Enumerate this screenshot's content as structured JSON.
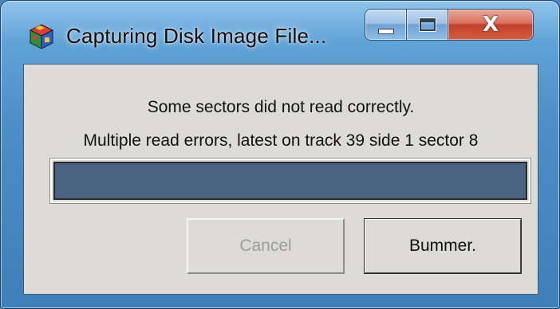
{
  "window": {
    "title": "Capturing Disk Image File...",
    "icon": "multicolor-cube-icon",
    "caption_buttons": {
      "minimize": "minimize-icon",
      "maximize": "maximize-icon",
      "close": "close-icon",
      "close_glyph": "X"
    }
  },
  "dialog": {
    "message": "Some sectors did not read correctly.",
    "detail": "Multiple read errors, latest on track 39 side 1 sector 8",
    "progress": {
      "fraction": 1.0,
      "fill_color": "#4a6380"
    },
    "buttons": {
      "cancel": {
        "label": "Cancel",
        "enabled": false
      },
      "ok": {
        "label": "Bummer.",
        "enabled": true
      }
    }
  },
  "colors": {
    "client_background": "#dddbd6",
    "close_button": "#c0402a"
  }
}
